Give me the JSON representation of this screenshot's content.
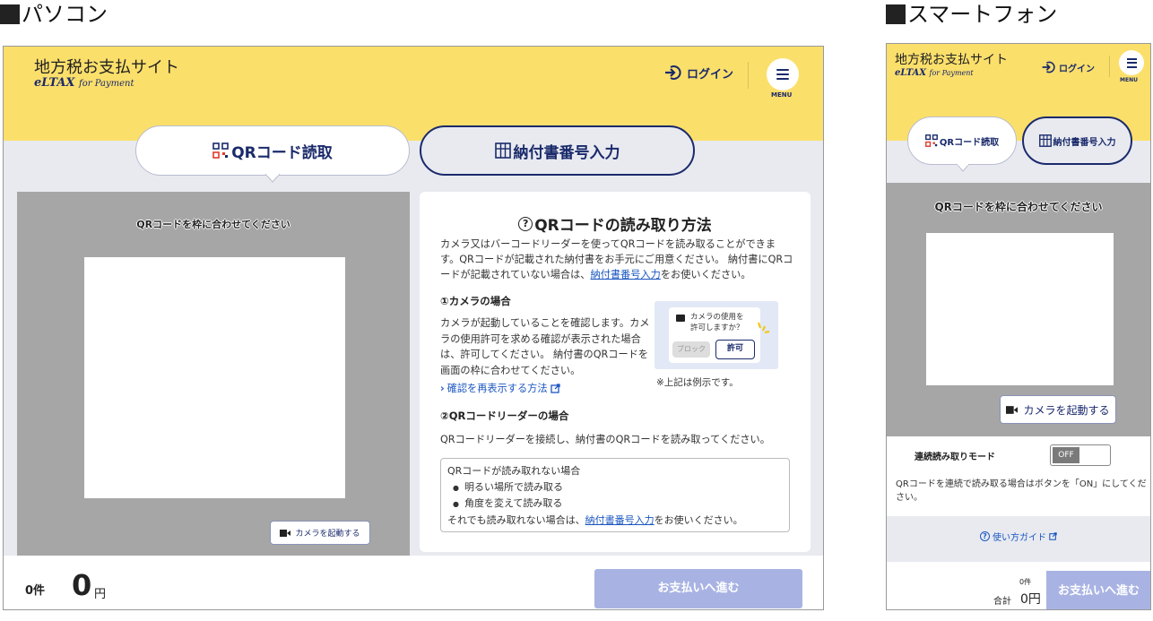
{
  "labels": {
    "pc": "パソコン",
    "sp": "スマートフォン"
  },
  "header": {
    "site_title": "地方税お支払サイト",
    "brand": "eLTAX",
    "brand_sub": "for Payment",
    "login": "ログイン",
    "menu": "MENU"
  },
  "tabs": [
    {
      "label": "QRコード読取",
      "active": true
    },
    {
      "label": "納付書番号入力",
      "active": false
    }
  ],
  "scanner": {
    "message": "QRコードを枠に合わせてください",
    "camera_button": "カメラを起動する"
  },
  "guide": {
    "title": "QRコードの読み取り方法",
    "intro_1": "カメラ又はバーコードリーダーを使ってQRコードを読み取ることができます。QRコードが記載された納付書をお手元にご用意ください。 納付書にQRコードが記載されていない場合は、",
    "intro_link": "納付書番号入力",
    "intro_2": "をお使いください。",
    "camera_heading": "①カメラの場合",
    "camera_desc": "カメラが起動していることを確認します。カメラの使用許可を求める確認が表示された場合は、許可してください。 納付書のQRコードを画面の枠に合わせてください。",
    "recheck_link": "確認を再表示する方法",
    "sample_line1": "カメラの使用を",
    "sample_line2": "許可しますか？",
    "sample_block": "ブロック",
    "sample_allow": "許可",
    "sample_note": "※上記は例示です。",
    "reader_heading": "②QRコードリーダーの場合",
    "reader_desc": "QRコードリーダーを接続し、納付書のQRコードを読み取ってください。",
    "note_title": "QRコードが読み取れない場合",
    "note_items": [
      "明るい場所で読み取る",
      "角度を変えて読み取る"
    ],
    "note_tail_1": "それでも読み取れない場合は、",
    "note_tail_link": "納付書番号入力",
    "note_tail_2": "をお使いください。"
  },
  "footer": {
    "count": "0件",
    "amount": "0",
    "yen": "円",
    "pay_button": "お支払いへ進む",
    "sp_total_label": "合計",
    "sp_amount": "0円"
  },
  "sp_mode": {
    "label": "連続読み取りモード",
    "toggle": "OFF",
    "desc": "QRコードを連続で読み取る場合はボタンを「ON」にしてください。"
  },
  "sp_guide_link": "使い方ガイド",
  "colors": {
    "header": "#fbdf6b",
    "navy": "#1a2a6b",
    "pay_button": "#a9b3e3",
    "scan_bg": "#a6a6a6"
  }
}
